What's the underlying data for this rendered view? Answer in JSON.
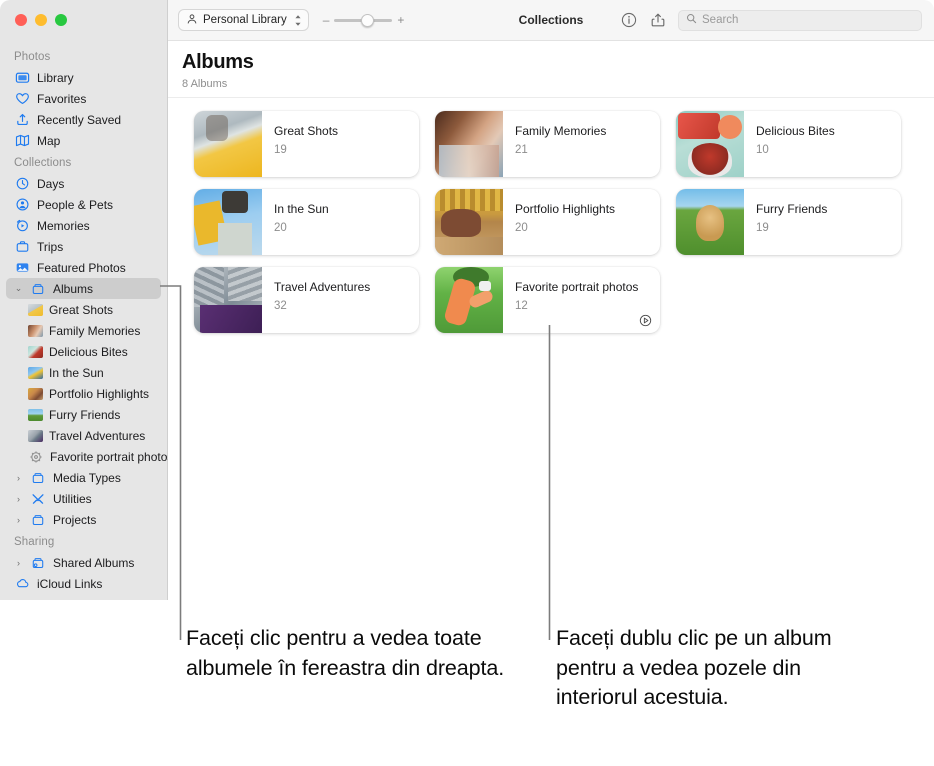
{
  "window": {
    "traffic_lights": [
      "close",
      "minimize",
      "zoom"
    ]
  },
  "toolbar": {
    "library_label": "Personal Library",
    "zoom_minus": "–",
    "zoom_plus": "+",
    "title": "Collections",
    "info_icon": "info-icon",
    "share_icon": "share-icon",
    "search_placeholder": "Search",
    "search_value": ""
  },
  "sidebar": {
    "sections": [
      {
        "header": "Photos",
        "items": [
          {
            "label": "Library",
            "icon": "library-icon"
          },
          {
            "label": "Favorites",
            "icon": "heart-icon"
          },
          {
            "label": "Recently Saved",
            "icon": "recently-saved-icon"
          },
          {
            "label": "Map",
            "icon": "map-icon"
          }
        ]
      },
      {
        "header": "Collections",
        "items": [
          {
            "label": "Days",
            "icon": "clock-icon"
          },
          {
            "label": "People & Pets",
            "icon": "people-icon"
          },
          {
            "label": "Memories",
            "icon": "memories-icon"
          },
          {
            "label": "Trips",
            "icon": "trips-icon"
          },
          {
            "label": "Featured Photos",
            "icon": "featured-photos-icon"
          },
          {
            "label": "Albums",
            "icon": "albums-icon",
            "selected": true,
            "expanded": true,
            "disclosure": "⌄"
          },
          {
            "label": "Great Shots",
            "icon": "album-thumb",
            "child": true
          },
          {
            "label": "Family Memories",
            "icon": "album-thumb",
            "child": true
          },
          {
            "label": "Delicious Bites",
            "icon": "album-thumb",
            "child": true
          },
          {
            "label": "In the Sun",
            "icon": "album-thumb",
            "child": true
          },
          {
            "label": "Portfolio Highlights",
            "icon": "album-thumb",
            "child": true
          },
          {
            "label": "Furry Friends",
            "icon": "album-thumb",
            "child": true
          },
          {
            "label": "Travel Adventures",
            "icon": "album-thumb",
            "child": true
          },
          {
            "label": "Favorite portrait photos",
            "icon": "smart-album-icon",
            "child": true
          },
          {
            "label": "Media Types",
            "icon": "media-types-icon",
            "disclosure": "›"
          },
          {
            "label": "Utilities",
            "icon": "utilities-icon",
            "disclosure": "›"
          },
          {
            "label": "Projects",
            "icon": "projects-icon",
            "disclosure": "›"
          }
        ]
      },
      {
        "header": "Sharing",
        "items": [
          {
            "label": "Shared Albums",
            "icon": "shared-albums-icon",
            "disclosure": "›"
          },
          {
            "label": "iCloud Links",
            "icon": "icloud-icon"
          }
        ]
      }
    ]
  },
  "main": {
    "title": "Albums",
    "subtitle": "8 Albums",
    "albums": [
      {
        "name": "Great Shots",
        "count": "19"
      },
      {
        "name": "Family Memories",
        "count": "21"
      },
      {
        "name": "Delicious Bites",
        "count": "10"
      },
      {
        "name": "In the Sun",
        "count": "20"
      },
      {
        "name": "Portfolio Highlights",
        "count": "20"
      },
      {
        "name": "Furry Friends",
        "count": "19"
      },
      {
        "name": "Travel Adventures",
        "count": "32"
      },
      {
        "name": "Favorite portrait photos",
        "count": "12",
        "badge": "smart-album-badge-icon"
      }
    ]
  },
  "callouts": {
    "left": "Faceți clic pentru a vedea toate albumele în fereastra din dreapta.",
    "right": "Faceți dublu clic pe un album pentru a vedea pozele din interiorul acestuia."
  },
  "colors": {
    "accent": "#0a7cf5",
    "sidebar_bg": "#e6e6e6",
    "selection": "#cdcdcd",
    "leader_line": "#7c7c7c"
  }
}
